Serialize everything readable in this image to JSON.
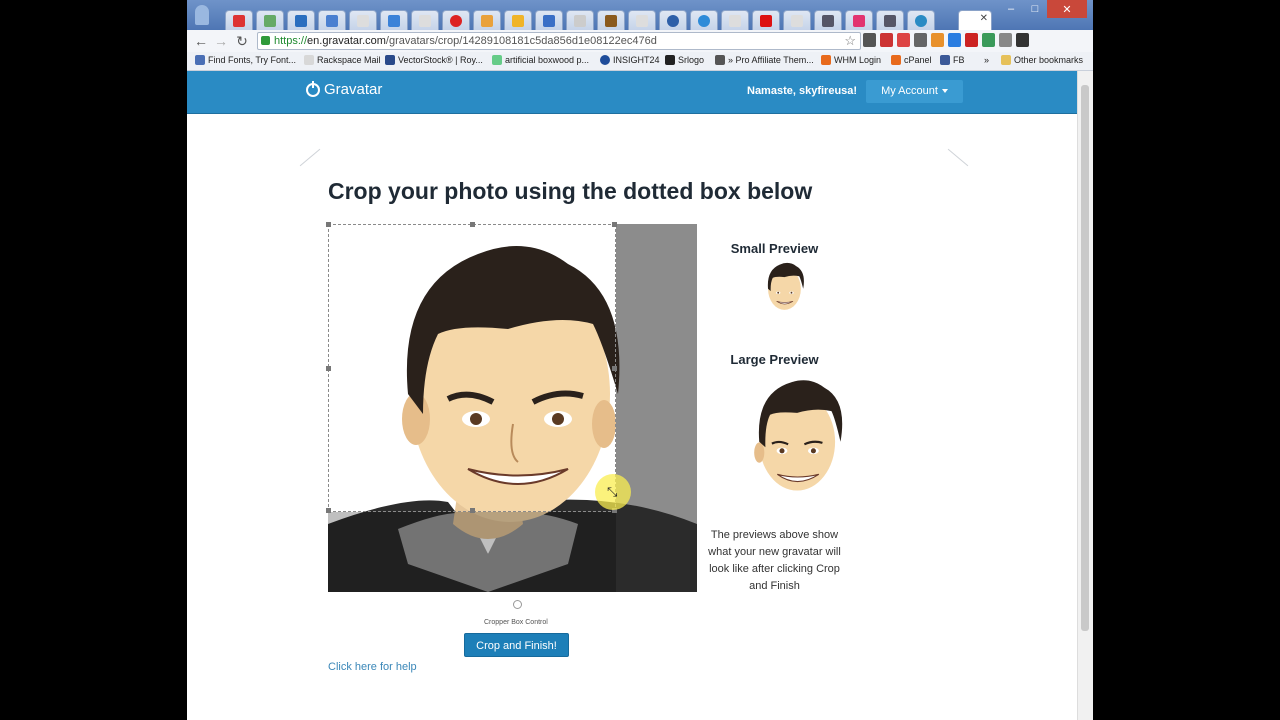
{
  "browser": {
    "url_scheme": "https://",
    "url_host": "en.gravatar.com",
    "url_path": "/gravatars/crop/14289108181c5da856d1e08122ec476d",
    "bookmarks": [
      "Find Fonts, Try Font...",
      "Rackspace Mail",
      "VectorStock® | Roy...",
      "artificial boxwood p...",
      "INSIGHT24",
      "Srlogo",
      "» Pro Affiliate Them...",
      "WHM Login",
      "cPanel",
      "FB",
      "»",
      "Other bookmarks"
    ]
  },
  "header": {
    "logo": "Gravatar",
    "greeting": "Namaste, skyfireusa!",
    "account": "My Account"
  },
  "main": {
    "title": "Crop your photo using the dotted box below",
    "small_preview": "Small Preview",
    "large_preview": "Large Preview",
    "note": "The previews above show what your new gravatar will look like after clicking Crop and Finish",
    "control_label": "Cropper Box Control",
    "crop_button": "Crop and Finish!",
    "help_link": "Click here for help"
  },
  "colors": {
    "header": "#2a8bc4",
    "button": "#1d7fb8",
    "link": "#3a87b8"
  }
}
